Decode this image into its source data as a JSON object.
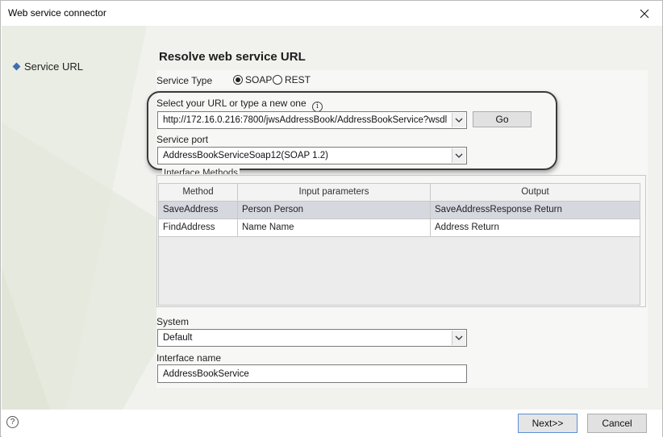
{
  "window": {
    "title": "Web service connector"
  },
  "nav": {
    "items": [
      {
        "label": "Service URL"
      }
    ]
  },
  "page": {
    "title": "Resolve web service URL"
  },
  "form": {
    "service_type": {
      "label": "Service Type",
      "options": [
        "SOAP",
        "REST"
      ],
      "selected": "SOAP"
    },
    "url": {
      "label": "Select your URL or type a new one",
      "value": "http://172.16.0.216:7800/jwsAddressBook/AddressBookService?wsdl",
      "go_label": "Go"
    },
    "port": {
      "label": "Service port",
      "value": "AddressBookServiceSoap12(SOAP 1.2)"
    },
    "interface_methods": {
      "legend": "Interface Methods",
      "columns": [
        "Method",
        "Input parameters",
        "Output"
      ],
      "rows": [
        [
          "SaveAddress",
          "Person Person",
          "SaveAddressResponse Return"
        ],
        [
          "FindAddress",
          "Name Name",
          "Address Return"
        ]
      ],
      "selected_row": 0
    },
    "system": {
      "label": "System",
      "value": "Default"
    },
    "interface_name": {
      "label": "Interface name",
      "value": "AddressBookService"
    }
  },
  "footer": {
    "help_icon": "?",
    "next_label": "Next>>",
    "cancel_label": "Cancel"
  },
  "icons": {
    "close": "close-icon",
    "help": "help-icon",
    "info": "info-icon",
    "dropdown": "chevron-down-icon"
  },
  "colors": {
    "accent": "#3f6fae",
    "selected_row": "#d5d8df",
    "panel_bg": "#f1f1ee"
  }
}
